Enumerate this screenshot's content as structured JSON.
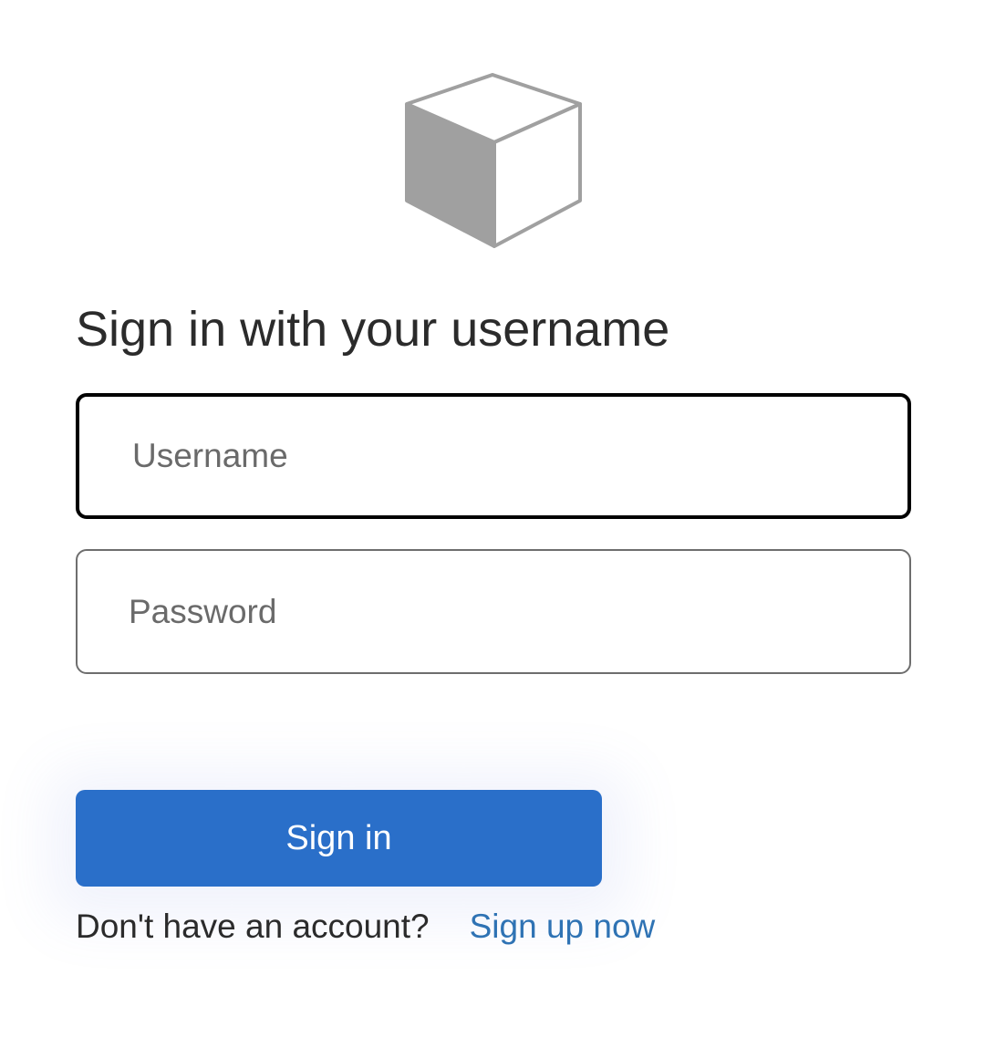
{
  "logo": {
    "icon": "cube-icon",
    "colors": {
      "shade": "#a0a0a0",
      "outline": "#a0a0a0",
      "face": "#ffffff"
    }
  },
  "heading": "Sign in with your username",
  "form": {
    "username": {
      "placeholder": "Username",
      "value": ""
    },
    "password": {
      "placeholder": "Password",
      "value": ""
    },
    "submit_label": "Sign in"
  },
  "signup": {
    "prompt": "Don't have an account?",
    "link_label": "Sign up now"
  },
  "colors": {
    "accent": "#2a6fc9",
    "link": "#2f73b4",
    "text": "#2b2b2b",
    "focused_border": "#000000"
  }
}
